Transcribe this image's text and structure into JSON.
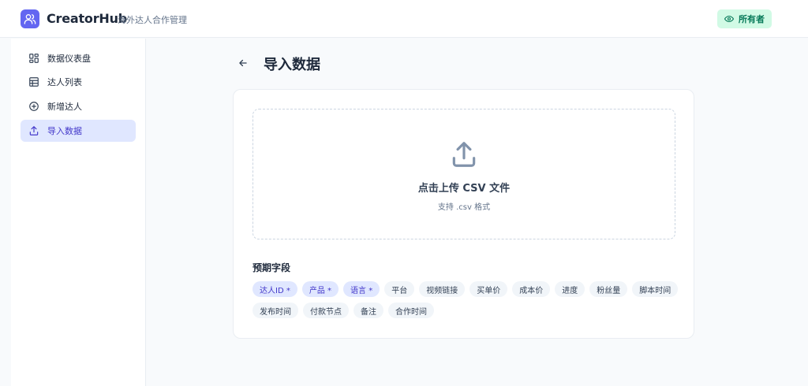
{
  "header": {
    "app_name": "CreatorHub",
    "subtitle": "海外达人合作管理",
    "role_badge": "所有者"
  },
  "sidebar": {
    "items": [
      {
        "label": "数据仪表盘",
        "icon": "dashboard-grid-icon",
        "active": false
      },
      {
        "label": "达人列表",
        "icon": "table-icon",
        "active": false
      },
      {
        "label": "新增达人",
        "icon": "plus-circle-icon",
        "active": false
      },
      {
        "label": "导入数据",
        "icon": "upload-icon",
        "active": true
      }
    ]
  },
  "main": {
    "title": "导入数据",
    "upload": {
      "title": "点击上传 CSV 文件",
      "hint": "支持 .csv 格式"
    },
    "fields_title": "预期字段",
    "fields": [
      {
        "label": "达人ID *",
        "required": true
      },
      {
        "label": "产品 *",
        "required": true
      },
      {
        "label": "语言 *",
        "required": true
      },
      {
        "label": "平台",
        "required": false
      },
      {
        "label": "视频链接",
        "required": false
      },
      {
        "label": "买单价",
        "required": false
      },
      {
        "label": "成本价",
        "required": false
      },
      {
        "label": "进度",
        "required": false
      },
      {
        "label": "粉丝量",
        "required": false
      },
      {
        "label": "脚本时间",
        "required": false
      },
      {
        "label": "发布时间",
        "required": false
      },
      {
        "label": "付款节点",
        "required": false
      },
      {
        "label": "备注",
        "required": false
      },
      {
        "label": "合作时间",
        "required": false
      }
    ]
  },
  "colors": {
    "accent": "#6366f1",
    "active_bg": "#e0e7ff",
    "active_text": "#4338ca",
    "badge_bg": "#d1fae5",
    "badge_text": "#047857"
  }
}
